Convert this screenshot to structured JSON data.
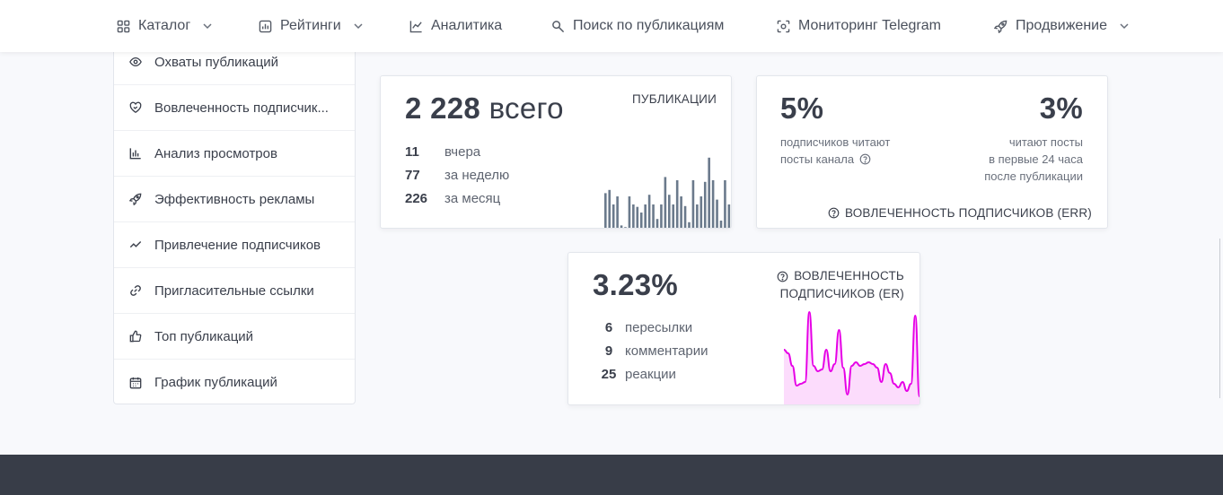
{
  "nav": {
    "items": [
      {
        "label": "Каталог",
        "icon": "grid-icon",
        "has_dropdown": true
      },
      {
        "label": "Рейтинги",
        "icon": "bar-chart-icon",
        "has_dropdown": true
      },
      {
        "label": "Аналитика",
        "icon": "line-chart-icon",
        "has_dropdown": false
      },
      {
        "label": "Поиск по публикациям",
        "icon": "search-icon",
        "has_dropdown": false
      },
      {
        "label": "Мониторинг Telegram",
        "icon": "scan-icon",
        "has_dropdown": false
      },
      {
        "label": "Продвижение",
        "icon": "rocket-icon",
        "has_dropdown": true
      }
    ]
  },
  "sidebar": {
    "items": [
      {
        "label": "Охваты публикаций",
        "icon": "eye-icon"
      },
      {
        "label": "Вовлеченность подписчик...",
        "icon": "heart-handshake-icon"
      },
      {
        "label": "Анализ просмотров",
        "icon": "bar-chart-icon"
      },
      {
        "label": "Эффективность рекламы",
        "icon": "rocket-icon"
      },
      {
        "label": "Привлечение подписчиков",
        "icon": "trend-icon"
      },
      {
        "label": "Пригласительные ссылки",
        "icon": "link-icon"
      },
      {
        "label": "Топ публикаций",
        "icon": "thumbs-up-icon"
      },
      {
        "label": "График публикаций",
        "icon": "calendar-icon"
      }
    ]
  },
  "publications": {
    "total": "2 228",
    "total_suffix": "всего",
    "label": "ПУБЛИКАЦИИ",
    "stats": [
      {
        "value": "11",
        "label": "вчера"
      },
      {
        "value": "77",
        "label": "за неделю"
      },
      {
        "value": "226",
        "label": "за месяц"
      }
    ],
    "bar_color": "#6b7a8c"
  },
  "err": {
    "left_value": "5%",
    "left_text_1": "подписчиков читают",
    "left_text_2": "посты канала",
    "right_value": "3%",
    "right_text_1": "читают посты",
    "right_text_2": "в первые 24 часа",
    "right_text_3": "после публикации",
    "label": "ВОВЛЕЧЕННОСТЬ ПОДПИСЧИКОВ (ERR)"
  },
  "er": {
    "value": "3.23%",
    "label_1": "ВОВЛЕЧЕННОСТЬ",
    "label_2": "ПОДПИСЧИКОВ (ER)",
    "stats": [
      {
        "value": "6",
        "label": "пересылки"
      },
      {
        "value": "9",
        "label": "комментарии"
      },
      {
        "value": "25",
        "label": "реакции"
      }
    ],
    "line_color": "#e600e6",
    "fill_color": "#fbd3fb"
  },
  "chart_data": [
    {
      "type": "bar",
      "values": [
        44,
        48,
        30,
        40,
        4,
        2,
        40,
        30,
        27,
        20,
        30,
        42,
        30,
        12,
        30,
        64,
        42,
        30,
        60,
        40,
        28,
        8,
        60,
        30,
        40,
        58,
        88,
        60,
        36,
        10,
        60,
        30
      ]
    },
    {
      "type": "area",
      "values": [
        58,
        54,
        40,
        18,
        20,
        22,
        100,
        40,
        34,
        36,
        58,
        34,
        42,
        80,
        38,
        8,
        40,
        44,
        40,
        42,
        44,
        42,
        38,
        22,
        42,
        32,
        20,
        16,
        22,
        12,
        20,
        96,
        6
      ]
    }
  ]
}
